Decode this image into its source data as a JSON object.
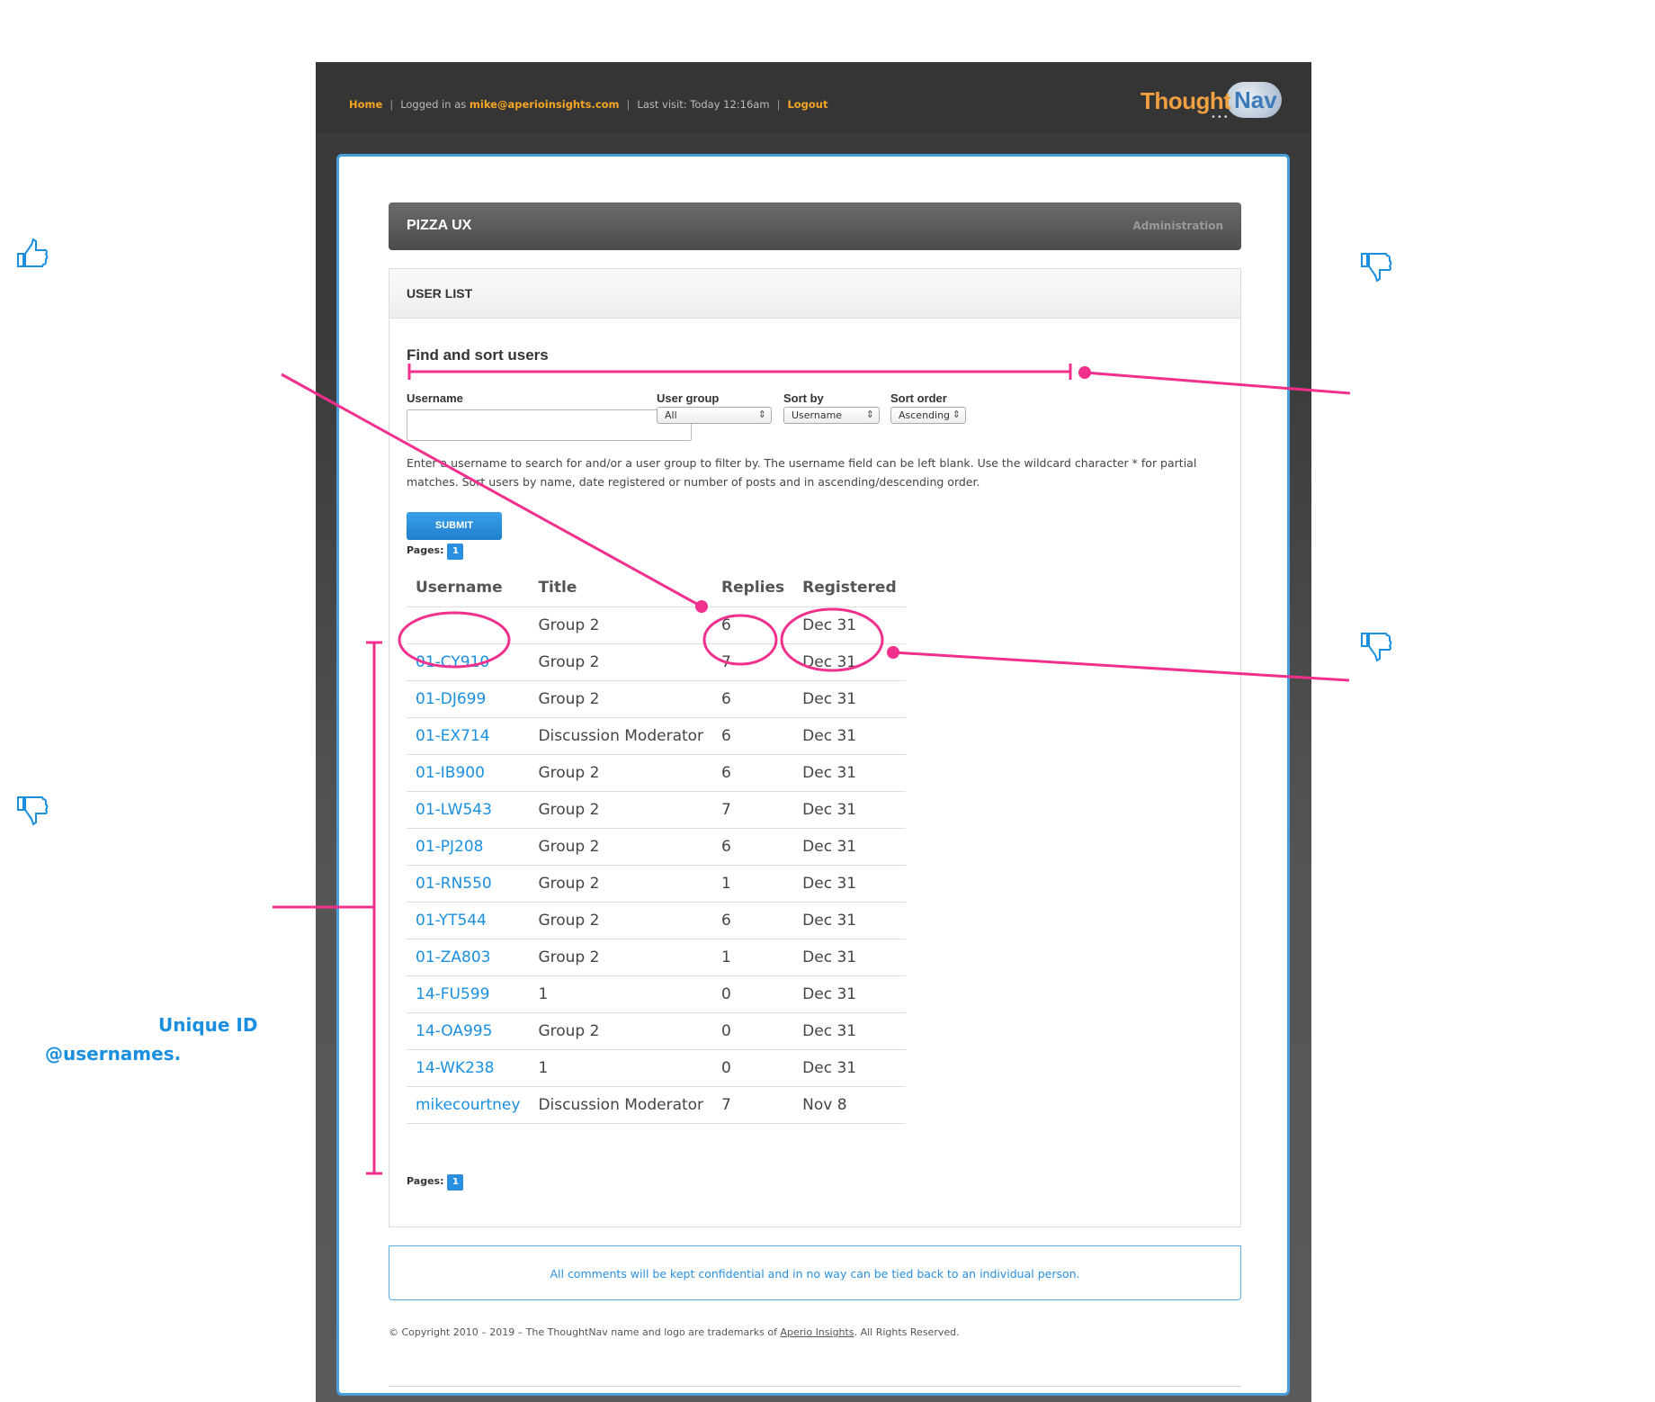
{
  "nav": {
    "home": "Home",
    "logged_in_prefix": "Logged in as",
    "email": "mike@aperioinsights.com",
    "last_visit": "Last visit: Today 12:16am",
    "logout": "Logout"
  },
  "logo": {
    "part1": "Thought",
    "part2": "Nav"
  },
  "page": {
    "title": "PIZZA UX",
    "admin_link": "Administration"
  },
  "panel": {
    "title": "USER LIST",
    "section_title": "Find and sort users",
    "labels": {
      "username": "Username",
      "user_group": "User group",
      "sort_by": "Sort by",
      "sort_order": "Sort order"
    },
    "username_value": "",
    "user_group_selected": "All",
    "sort_by_selected": "Username",
    "sort_order_selected": "Ascending",
    "help_text": "Enter a username to search for and/or a user group to filter by. The username field can be left blank. Use the wildcard character * for partial matches. Sort users by name, date registered or number of posts and in ascending/descending order.",
    "submit": "SUBMIT",
    "pages_label": "Pages:",
    "current_page": "1"
  },
  "table": {
    "headers": [
      "Username",
      "Title",
      "Replies",
      "Registered"
    ],
    "rows": [
      [
        "",
        "Group 2",
        "6",
        "Dec 31"
      ],
      [
        "01-CY910",
        "Group 2",
        "7",
        "Dec 31"
      ],
      [
        "01-DJ699",
        "Group 2",
        "6",
        "Dec 31"
      ],
      [
        "01-EX714",
        "Discussion Moderator",
        "6",
        "Dec 31"
      ],
      [
        "01-IB900",
        "Group 2",
        "6",
        "Dec 31"
      ],
      [
        "01-LW543",
        "Group 2",
        "7",
        "Dec 31"
      ],
      [
        "01-PJ208",
        "Group 2",
        "6",
        "Dec 31"
      ],
      [
        "01-RN550",
        "Group 2",
        "1",
        "Dec 31"
      ],
      [
        "01-YT544",
        "Group 2",
        "6",
        "Dec 31"
      ],
      [
        "01-ZA803",
        "Group 2",
        "1",
        "Dec 31"
      ],
      [
        "14-FU599",
        "1",
        "0",
        "Dec 31"
      ],
      [
        "14-OA995",
        "Group 2",
        "0",
        "Dec 31"
      ],
      [
        "14-WK238",
        "1",
        "0",
        "Dec 31"
      ],
      [
        "mikecourtney",
        "Discussion Moderator",
        "7",
        "Nov 8"
      ]
    ]
  },
  "notice": "All comments will be kept confidential and in no way can be tied back to an individual person.",
  "footer": {
    "copyright_prefix": "© Copyright 2010 – 2019 – The ThoughtNav name and logo are trademarks of",
    "company": "Aperio Insights",
    "copyright_suffix": ". All Rights Reserved."
  },
  "annotations": {
    "callout_line1": "Unique ID",
    "callout_line2": "@usernames.",
    "accent_color": "#f0308c",
    "icon_color": "#1a8fe0",
    "icons": [
      "thumbs-up-icon",
      "thumbs-down-icon",
      "thumbs-down-icon",
      "thumbs-down-icon"
    ]
  }
}
